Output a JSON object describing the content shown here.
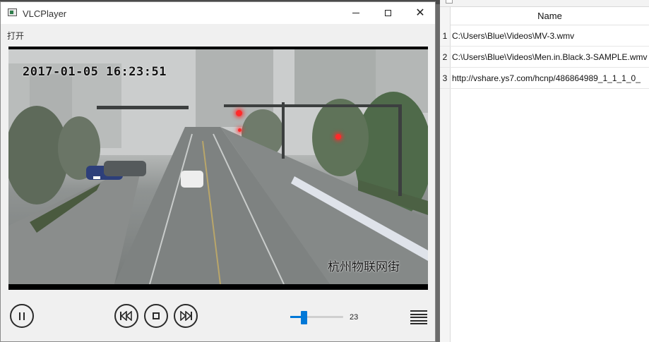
{
  "window": {
    "title": "VLCPlayer",
    "menu": {
      "open_label": "打开"
    }
  },
  "video": {
    "timestamp_overlay": "2017-01-05 16:23:51",
    "location_overlay": "杭州物联网街"
  },
  "controls": {
    "volume_value": "23",
    "volume_fraction": 0.23
  },
  "playlist": {
    "column_header": "Name",
    "rows": [
      {
        "num": "1",
        "name": "C:\\Users\\Blue\\Videos\\MV-3.wmv"
      },
      {
        "num": "2",
        "name": "C:\\Users\\Blue\\Videos\\Men.in.Black.3-SAMPLE.wmv"
      },
      {
        "num": "3",
        "name": "http://vshare.ys7.com/hcnp/486864989_1_1_1_0_"
      }
    ]
  },
  "icons": {
    "app": "vlc-app-icon",
    "minimize": "minimize-icon",
    "maximize": "maximize-icon",
    "close": "close-icon",
    "pause": "pause-icon",
    "previous": "previous-icon",
    "stop": "stop-icon",
    "next": "next-icon",
    "playlist": "playlist-icon"
  },
  "colors": {
    "accent": "#0078d7",
    "traffic_light": "#ff2a2a"
  }
}
